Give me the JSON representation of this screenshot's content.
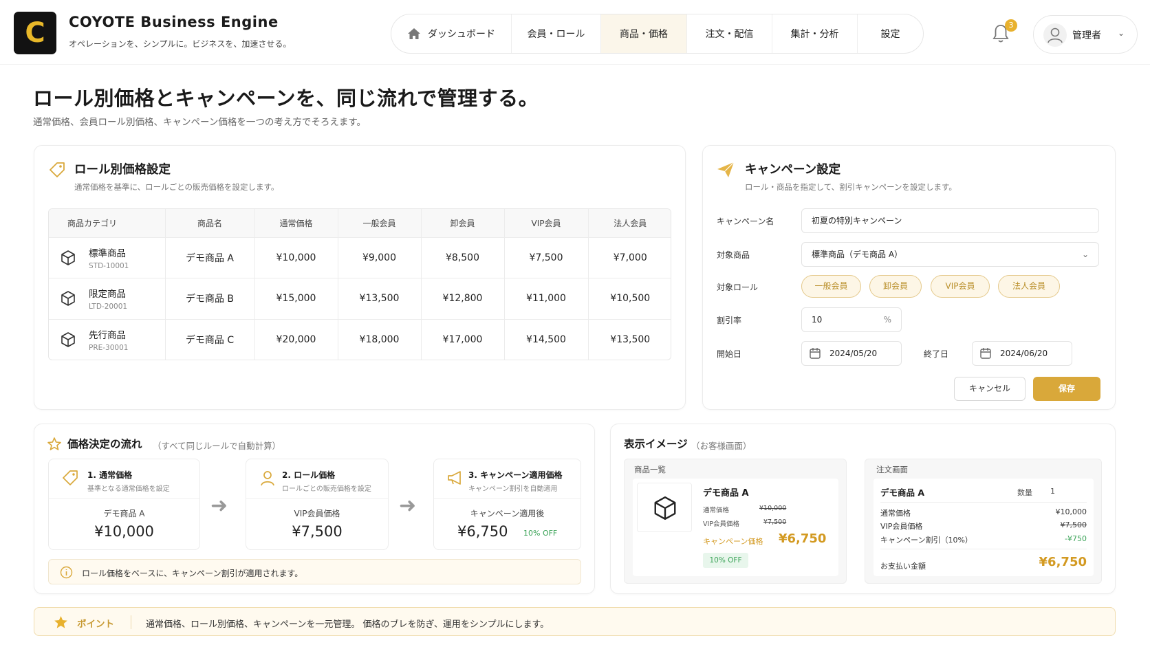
{
  "app": {
    "logo_letter": "C",
    "brand": "COYOTE Business Engine",
    "tagline": "オペレーションを、シンプルに。ビジネスを、加速させる。",
    "accent": "#d9a83a"
  },
  "nav": {
    "items": [
      {
        "label": "ダッシュボード",
        "icon": "home-icon"
      },
      {
        "label": "会員・ロール"
      },
      {
        "label": "商品・価格",
        "active": true
      },
      {
        "label": "注文・配信"
      },
      {
        "label": "集計・分析"
      },
      {
        "label": "設定"
      }
    ]
  },
  "header": {
    "notification_count": "3",
    "user_name": "管理者"
  },
  "page": {
    "title": "ロール別価格とキャンペーンを、同じ流れで管理する。",
    "subtitle": "通常価格、会員ロール別価格、キャンペーン価格を一つの考え方でそろえます。"
  },
  "role_pricing": {
    "title": "ロール別価格設定",
    "subtitle": "通常価格を基準に、ロールごとの販売価格を設定します。",
    "columns": [
      "商品カテゴリ",
      "商品名",
      "通常価格",
      "一般会員",
      "卸会員",
      "VIP会員",
      "法人会員"
    ],
    "rows": [
      {
        "category": "標準商品",
        "code": "STD-10001",
        "product": "デモ商品 A",
        "prices": [
          "¥10,000",
          "¥9,000",
          "¥8,500",
          "¥7,500",
          "¥7,000"
        ]
      },
      {
        "category": "限定商品",
        "code": "LTD-20001",
        "product": "デモ商品 B",
        "prices": [
          "¥15,000",
          "¥13,500",
          "¥12,800",
          "¥11,000",
          "¥10,500"
        ]
      },
      {
        "category": "先行商品",
        "code": "PRE-30001",
        "product": "デモ商品 C",
        "prices": [
          "¥20,000",
          "¥18,000",
          "¥17,000",
          "¥14,500",
          "¥13,500"
        ]
      }
    ]
  },
  "campaign": {
    "title": "キャンペーン設定",
    "subtitle": "ロール・商品を指定して、割引キャンペーンを設定します。",
    "name_label": "キャンペーン名",
    "name_value": "初夏の特別キャンペーン",
    "product_label": "対象商品",
    "product_value": "標準商品（デモ商品 A）",
    "roles_label": "対象ロール",
    "roles": [
      "一般会員",
      "卸会員",
      "VIP会員",
      "法人会員"
    ],
    "discount_label": "割引率",
    "discount_value": "10",
    "discount_unit": "%",
    "start_label": "開始日",
    "start_value": "2024/05/20",
    "end_label": "終了日",
    "end_value": "2024/06/20",
    "cancel_label": "キャンセル",
    "save_label": "保存"
  },
  "flow": {
    "title": "価格決定の流れ",
    "title_note": "（すべて同じルールで自動計算）",
    "steps": [
      {
        "title": "1. 通常価格",
        "desc": "基準となる通常価格を設定",
        "label": "デモ商品 A",
        "price": "¥10,000"
      },
      {
        "title": "2. ロール価格",
        "desc": "ロールごとの販売価格を設定",
        "label": "VIP会員価格",
        "price": "¥7,500"
      },
      {
        "title": "3. キャンペーン適用価格",
        "desc": "キャンペーン割引を自動適用",
        "label": "キャンペーン適用後",
        "price": "¥6,750",
        "badge": "10% OFF"
      }
    ],
    "note": "ロール価格をベースに、キャンペーン割引が適用されます。"
  },
  "preview": {
    "title": "表示イメージ",
    "title_note": "（お客様画面）",
    "list": {
      "header": "商品一覧",
      "product": "デモ商品 A",
      "regular_label": "通常価格",
      "regular_price": "¥10,000",
      "vip_label": "VIP会員価格",
      "vip_price": "¥7,500",
      "campaign_label": "キャンペーン価格",
      "campaign_price": "¥6,750",
      "badge": "10% OFF"
    },
    "order": {
      "header": "注文画面",
      "product": "デモ商品 A",
      "qty_label": "数量",
      "qty_value": "1",
      "regular_label": "通常価格",
      "regular_price": "¥10,000",
      "vip_label": "VIP会員価格",
      "vip_price": "¥7,500",
      "discount_label": "キャンペーン割引（10%）",
      "discount_value": "-¥750",
      "total_label": "お支払い金額",
      "total_value": "¥6,750"
    }
  },
  "tip": {
    "label": "ポイント",
    "text": "通常価格、ロール別価格、キャンペーンを一元管理。 価格のブレを防ぎ、運用をシンプルにします。"
  }
}
